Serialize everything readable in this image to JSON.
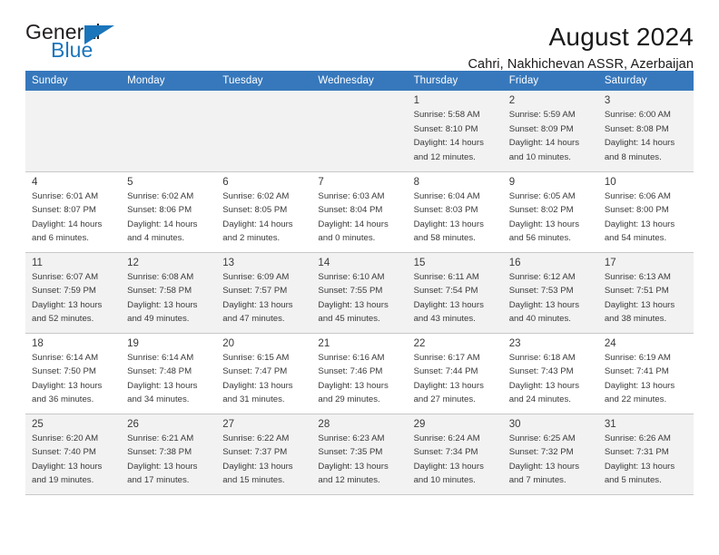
{
  "brand": {
    "name_top": "General",
    "name_bottom": "Blue",
    "color_primary": "#1b75bb",
    "color_text": "#231f20"
  },
  "header": {
    "title": "August 2024",
    "subtitle": "Cahri, Nakhichevan ASSR, Azerbaijan"
  },
  "calendar": {
    "header_background": "#3778bc",
    "header_text_color": "#ffffff",
    "weekday_headers": [
      "Sunday",
      "Monday",
      "Tuesday",
      "Wednesday",
      "Thursday",
      "Friday",
      "Saturday"
    ],
    "weeks": [
      [
        {
          "day": "",
          "empty": true
        },
        {
          "day": "",
          "empty": true
        },
        {
          "day": "",
          "empty": true
        },
        {
          "day": "",
          "empty": true
        },
        {
          "day": "1",
          "sunrise": "Sunrise: 5:58 AM",
          "sunset": "Sunset: 8:10 PM",
          "daylight_1": "Daylight: 14 hours",
          "daylight_2": "and 12 minutes."
        },
        {
          "day": "2",
          "sunrise": "Sunrise: 5:59 AM",
          "sunset": "Sunset: 8:09 PM",
          "daylight_1": "Daylight: 14 hours",
          "daylight_2": "and 10 minutes."
        },
        {
          "day": "3",
          "sunrise": "Sunrise: 6:00 AM",
          "sunset": "Sunset: 8:08 PM",
          "daylight_1": "Daylight: 14 hours",
          "daylight_2": "and 8 minutes."
        }
      ],
      [
        {
          "day": "4",
          "sunrise": "Sunrise: 6:01 AM",
          "sunset": "Sunset: 8:07 PM",
          "daylight_1": "Daylight: 14 hours",
          "daylight_2": "and 6 minutes."
        },
        {
          "day": "5",
          "sunrise": "Sunrise: 6:02 AM",
          "sunset": "Sunset: 8:06 PM",
          "daylight_1": "Daylight: 14 hours",
          "daylight_2": "and 4 minutes."
        },
        {
          "day": "6",
          "sunrise": "Sunrise: 6:02 AM",
          "sunset": "Sunset: 8:05 PM",
          "daylight_1": "Daylight: 14 hours",
          "daylight_2": "and 2 minutes."
        },
        {
          "day": "7",
          "sunrise": "Sunrise: 6:03 AM",
          "sunset": "Sunset: 8:04 PM",
          "daylight_1": "Daylight: 14 hours",
          "daylight_2": "and 0 minutes."
        },
        {
          "day": "8",
          "sunrise": "Sunrise: 6:04 AM",
          "sunset": "Sunset: 8:03 PM",
          "daylight_1": "Daylight: 13 hours",
          "daylight_2": "and 58 minutes."
        },
        {
          "day": "9",
          "sunrise": "Sunrise: 6:05 AM",
          "sunset": "Sunset: 8:02 PM",
          "daylight_1": "Daylight: 13 hours",
          "daylight_2": "and 56 minutes."
        },
        {
          "day": "10",
          "sunrise": "Sunrise: 6:06 AM",
          "sunset": "Sunset: 8:00 PM",
          "daylight_1": "Daylight: 13 hours",
          "daylight_2": "and 54 minutes."
        }
      ],
      [
        {
          "day": "11",
          "sunrise": "Sunrise: 6:07 AM",
          "sunset": "Sunset: 7:59 PM",
          "daylight_1": "Daylight: 13 hours",
          "daylight_2": "and 52 minutes."
        },
        {
          "day": "12",
          "sunrise": "Sunrise: 6:08 AM",
          "sunset": "Sunset: 7:58 PM",
          "daylight_1": "Daylight: 13 hours",
          "daylight_2": "and 49 minutes."
        },
        {
          "day": "13",
          "sunrise": "Sunrise: 6:09 AM",
          "sunset": "Sunset: 7:57 PM",
          "daylight_1": "Daylight: 13 hours",
          "daylight_2": "and 47 minutes."
        },
        {
          "day": "14",
          "sunrise": "Sunrise: 6:10 AM",
          "sunset": "Sunset: 7:55 PM",
          "daylight_1": "Daylight: 13 hours",
          "daylight_2": "and 45 minutes."
        },
        {
          "day": "15",
          "sunrise": "Sunrise: 6:11 AM",
          "sunset": "Sunset: 7:54 PM",
          "daylight_1": "Daylight: 13 hours",
          "daylight_2": "and 43 minutes."
        },
        {
          "day": "16",
          "sunrise": "Sunrise: 6:12 AM",
          "sunset": "Sunset: 7:53 PM",
          "daylight_1": "Daylight: 13 hours",
          "daylight_2": "and 40 minutes."
        },
        {
          "day": "17",
          "sunrise": "Sunrise: 6:13 AM",
          "sunset": "Sunset: 7:51 PM",
          "daylight_1": "Daylight: 13 hours",
          "daylight_2": "and 38 minutes."
        }
      ],
      [
        {
          "day": "18",
          "sunrise": "Sunrise: 6:14 AM",
          "sunset": "Sunset: 7:50 PM",
          "daylight_1": "Daylight: 13 hours",
          "daylight_2": "and 36 minutes."
        },
        {
          "day": "19",
          "sunrise": "Sunrise: 6:14 AM",
          "sunset": "Sunset: 7:48 PM",
          "daylight_1": "Daylight: 13 hours",
          "daylight_2": "and 34 minutes."
        },
        {
          "day": "20",
          "sunrise": "Sunrise: 6:15 AM",
          "sunset": "Sunset: 7:47 PM",
          "daylight_1": "Daylight: 13 hours",
          "daylight_2": "and 31 minutes."
        },
        {
          "day": "21",
          "sunrise": "Sunrise: 6:16 AM",
          "sunset": "Sunset: 7:46 PM",
          "daylight_1": "Daylight: 13 hours",
          "daylight_2": "and 29 minutes."
        },
        {
          "day": "22",
          "sunrise": "Sunrise: 6:17 AM",
          "sunset": "Sunset: 7:44 PM",
          "daylight_1": "Daylight: 13 hours",
          "daylight_2": "and 27 minutes."
        },
        {
          "day": "23",
          "sunrise": "Sunrise: 6:18 AM",
          "sunset": "Sunset: 7:43 PM",
          "daylight_1": "Daylight: 13 hours",
          "daylight_2": "and 24 minutes."
        },
        {
          "day": "24",
          "sunrise": "Sunrise: 6:19 AM",
          "sunset": "Sunset: 7:41 PM",
          "daylight_1": "Daylight: 13 hours",
          "daylight_2": "and 22 minutes."
        }
      ],
      [
        {
          "day": "25",
          "sunrise": "Sunrise: 6:20 AM",
          "sunset": "Sunset: 7:40 PM",
          "daylight_1": "Daylight: 13 hours",
          "daylight_2": "and 19 minutes."
        },
        {
          "day": "26",
          "sunrise": "Sunrise: 6:21 AM",
          "sunset": "Sunset: 7:38 PM",
          "daylight_1": "Daylight: 13 hours",
          "daylight_2": "and 17 minutes."
        },
        {
          "day": "27",
          "sunrise": "Sunrise: 6:22 AM",
          "sunset": "Sunset: 7:37 PM",
          "daylight_1": "Daylight: 13 hours",
          "daylight_2": "and 15 minutes."
        },
        {
          "day": "28",
          "sunrise": "Sunrise: 6:23 AM",
          "sunset": "Sunset: 7:35 PM",
          "daylight_1": "Daylight: 13 hours",
          "daylight_2": "and 12 minutes."
        },
        {
          "day": "29",
          "sunrise": "Sunrise: 6:24 AM",
          "sunset": "Sunset: 7:34 PM",
          "daylight_1": "Daylight: 13 hours",
          "daylight_2": "and 10 minutes."
        },
        {
          "day": "30",
          "sunrise": "Sunrise: 6:25 AM",
          "sunset": "Sunset: 7:32 PM",
          "daylight_1": "Daylight: 13 hours",
          "daylight_2": "and 7 minutes."
        },
        {
          "day": "31",
          "sunrise": "Sunrise: 6:26 AM",
          "sunset": "Sunset: 7:31 PM",
          "daylight_1": "Daylight: 13 hours",
          "daylight_2": "and 5 minutes."
        }
      ]
    ]
  }
}
